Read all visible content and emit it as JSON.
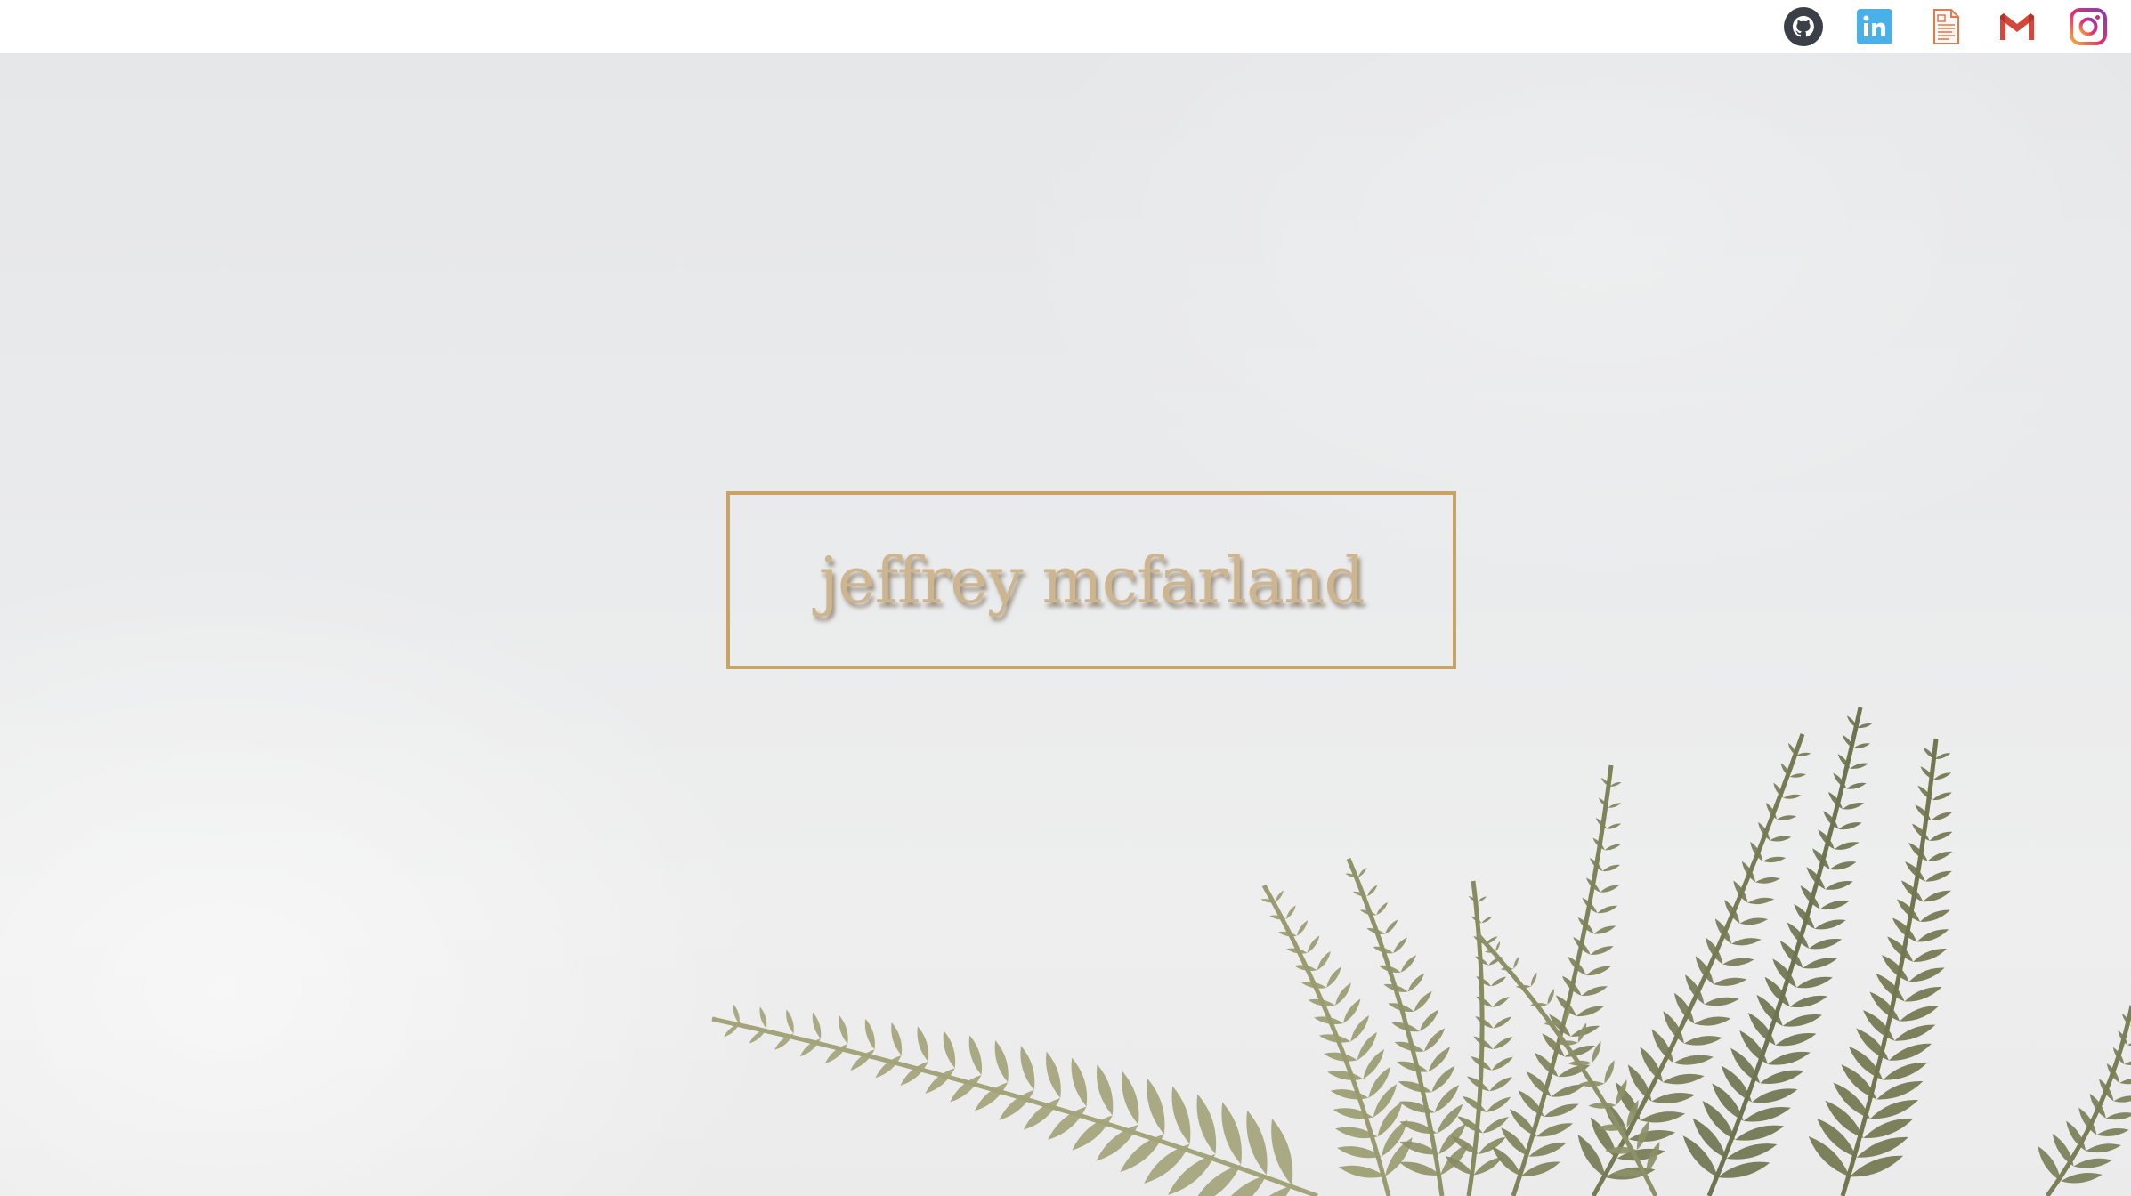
{
  "header": {
    "links": [
      {
        "name": "github",
        "icon": "github-icon",
        "color": "#3b3f47"
      },
      {
        "name": "linkedin",
        "icon": "linkedin-icon",
        "color": "#4ab0e8"
      },
      {
        "name": "resume",
        "icon": "resume-document-icon",
        "color": "#e07a52"
      },
      {
        "name": "gmail",
        "icon": "gmail-icon",
        "color": "#d4473a"
      },
      {
        "name": "instagram",
        "icon": "instagram-icon",
        "color": "#c9307a"
      }
    ]
  },
  "hero": {
    "title": "jeffrey mcfarland",
    "border_color": "#c9a266",
    "title_color": "#cdb58f",
    "background_image": "fern-icon"
  }
}
